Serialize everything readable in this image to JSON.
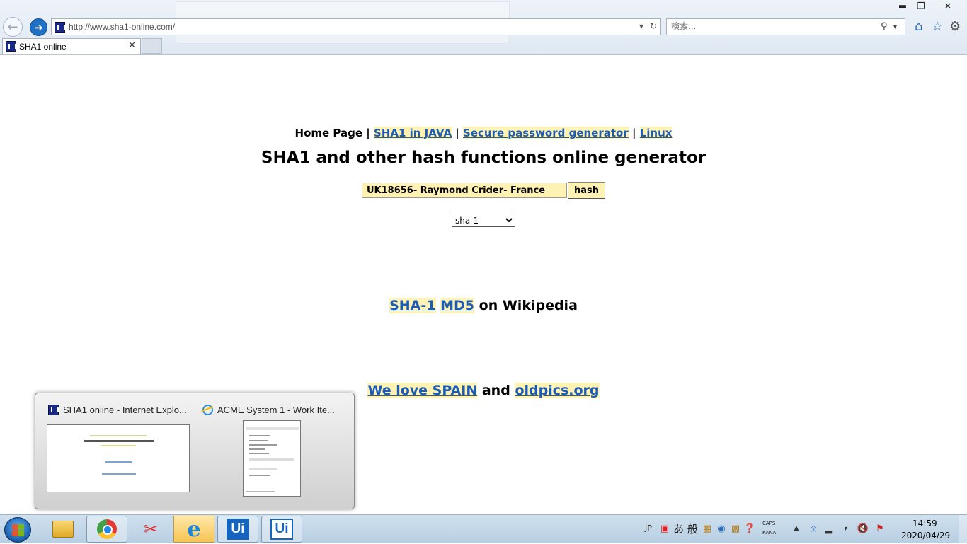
{
  "browser": {
    "url": "http://www.sha1-online.com/",
    "search_placeholder": "検索...",
    "tab_title": "SHA1 online"
  },
  "page": {
    "nav": {
      "home": "Home Page",
      "sep": "|",
      "links": [
        "SHA1 in JAVA",
        "Secure password generator",
        "Linux"
      ]
    },
    "heading": "SHA1 and other hash functions online generator",
    "input_value": "UK18656- Raymond Crider- France",
    "hash_button": "hash",
    "algorithm_selected": "sha-1",
    "wiki": {
      "link1": "SHA-1",
      "link2": "MD5",
      "suffix": "on Wikipedia"
    },
    "love": {
      "link1": "We love SPAIN",
      "conj": "and",
      "link2": "oldpics.org"
    }
  },
  "preview": {
    "items": [
      {
        "title": "SHA1 online - Internet Explo...",
        "icon": "sha1-favicon"
      },
      {
        "title": "ACME System 1 - Work Ite...",
        "icon": "internet-explorer-icon"
      }
    ]
  },
  "taskbar": {
    "apps": [
      "file-explorer",
      "chrome",
      "snipping-tool",
      "internet-explorer",
      "uipath-studio",
      "uipath-robot"
    ],
    "tray_lang": "JP",
    "tray_ime": "あ 般",
    "caps": "CAPS",
    "kana": "KANA",
    "time": "14:59",
    "date": "2020/04/29"
  }
}
